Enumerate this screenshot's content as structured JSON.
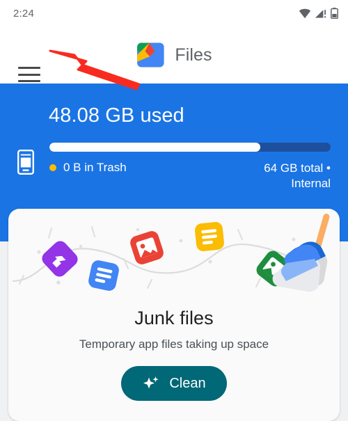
{
  "status_bar": {
    "time": "2:24",
    "icons": [
      {
        "name": "wifi-icon",
        "label": "wifi"
      },
      {
        "name": "cellular-signal-alert-icon",
        "label": "signal-no-service"
      },
      {
        "name": "battery-icon",
        "label": "battery"
      }
    ]
  },
  "app_bar": {
    "menu_label": "Menu",
    "app_name": "Files",
    "logo_name": "files-app-logo"
  },
  "storage": {
    "used_text": "48.08 GB used",
    "used_percent": 75,
    "device_icon": "smartphone-icon",
    "trash_text": "0 B in Trash",
    "trash_dot_color": "#fbbc04",
    "total_text": "64 GB total •\nInternal",
    "total_line1": "64 GB total •",
    "total_line2": "Internal",
    "panel_color": "#1b74e4",
    "bar_track_color": "#1e4f9c",
    "bar_fill_color": "#ffffff"
  },
  "junk_card": {
    "title": "Junk files",
    "subtitle": "Temporary app files taking up space",
    "button_label": "Clean",
    "button_icon": "sparkle-icon",
    "button_color": "#006876",
    "illustration_items": [
      {
        "name": "audio-file-icon",
        "color": "#9334e6"
      },
      {
        "name": "document-file-icon",
        "color": "#4285f4"
      },
      {
        "name": "image-file-icon",
        "color": "#ea4335"
      },
      {
        "name": "note-file-icon",
        "color": "#fbbc04"
      },
      {
        "name": "image-file-icon-green",
        "color": "#1e8e3e"
      },
      {
        "name": "broom-dustpan-icon",
        "color": "#4285f4"
      }
    ]
  },
  "annotation": {
    "arrow_color": "#f92b20",
    "arrow_target": "hamburger-menu-button"
  }
}
